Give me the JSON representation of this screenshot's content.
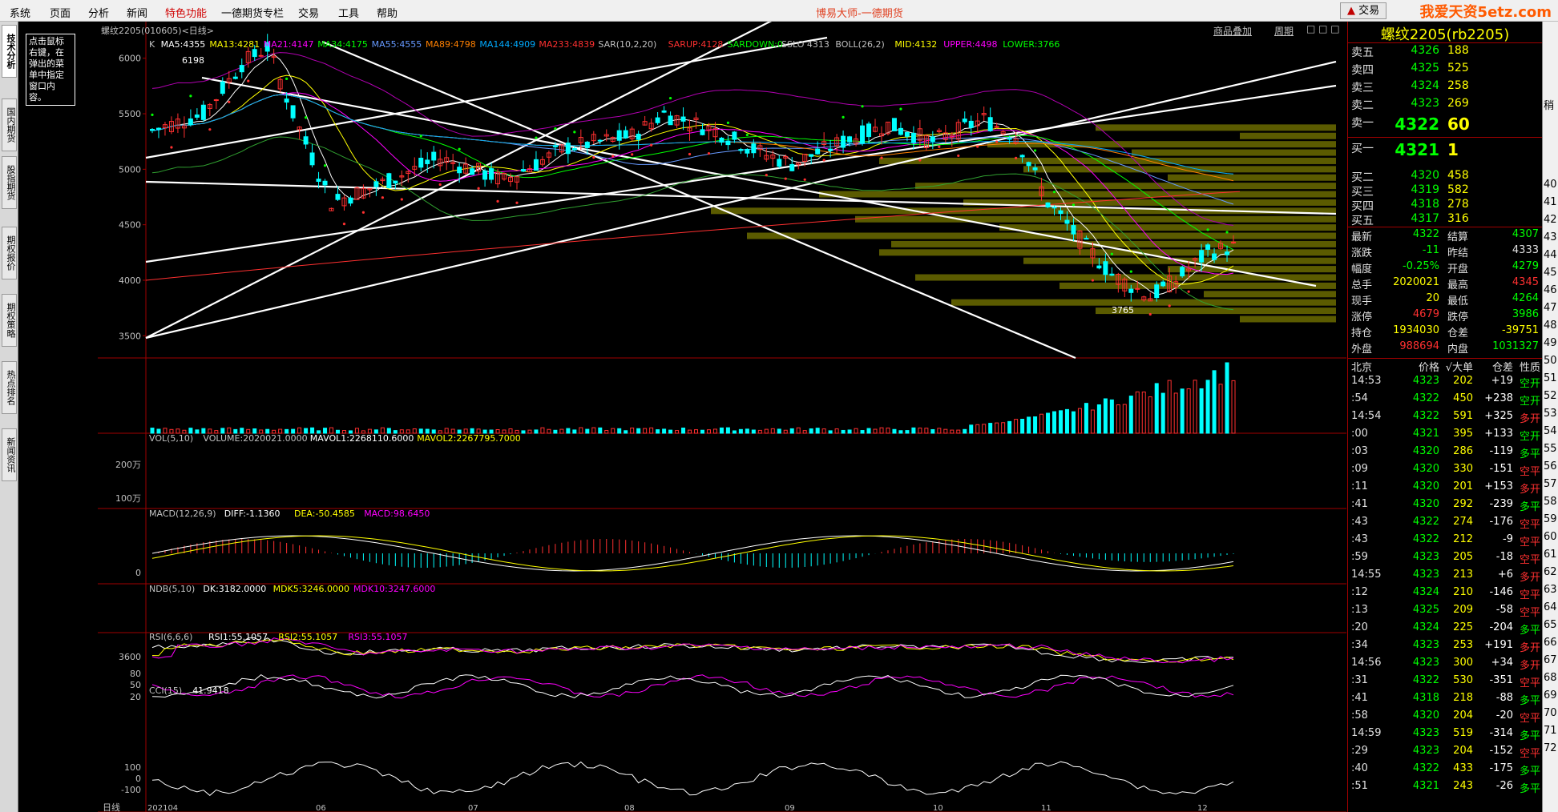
{
  "menu": {
    "items": [
      "系统",
      "页面",
      "分析",
      "新闻",
      "特色功能",
      "一德期货专栏",
      "交易",
      "工具",
      "帮助"
    ],
    "highlighted": "特色功能",
    "app_title": "博易大师-一德期货",
    "trade_button": "交易",
    "watermark": "我爱天资5etz.com"
  },
  "left_tabs": [
    "技术分析",
    "国内期货",
    "股指期货",
    "期权报价",
    "期权策略",
    "热点排名",
    "新闻资讯"
  ],
  "tooltip": "点击鼠标右键，在弹出的菜单中指定窗口内容。",
  "chart_header": {
    "title": "螺纹2205(010605)<日线>",
    "overlay_link": "商品叠加",
    "period_link": "周期"
  },
  "price_panel": {
    "indicator_line": [
      {
        "text": "K",
        "color": "#c0c0c0"
      },
      {
        "text": "MA5:4355",
        "color": "#ffffff"
      },
      {
        "text": "MA13:4281",
        "color": "#ffff00"
      },
      {
        "text": "MA21:4147",
        "color": "#ff00ff"
      },
      {
        "text": "MA34:4175",
        "color": "#00ff00"
      },
      {
        "text": "MA55:4555",
        "color": "#6699ff"
      },
      {
        "text": "MA89:4798",
        "color": "#ff8000"
      },
      {
        "text": "MA144:4909",
        "color": "#00aaff"
      },
      {
        "text": "MA233:4839",
        "color": "#ff3030"
      },
      {
        "text": "SAR(10,2,20)",
        "color": "#c0c0c0"
      },
      {
        "text": "SARUP:4128",
        "color": "#ff3030"
      },
      {
        "text": "SARDOWN:0",
        "color": "#00ff00"
      },
      {
        "text": "SSLO 4313",
        "color": "#c0c0c0"
      },
      {
        "text": "BOLL(26,2)",
        "color": "#c0c0c0"
      },
      {
        "text": "MID:4132",
        "color": "#ffff00"
      },
      {
        "text": "UPPER:4498",
        "color": "#ff00ff"
      },
      {
        "text": "LOWER:3766",
        "color": "#00ff00"
      }
    ],
    "y_ticks": [
      "6000",
      "5500",
      "5000",
      "4500",
      "4000",
      "3500"
    ],
    "y_tick_values": [
      6000,
      5500,
      5000,
      4500,
      4000,
      3500
    ],
    "high_label": "6198",
    "low_label": "3765"
  },
  "volume_panel": {
    "indicator_line": [
      {
        "text": "VOL(5,10)",
        "color": "#c0c0c0"
      },
      {
        "text": "VOLUME:2020021.0000",
        "color": "#c0c0c0"
      },
      {
        "text": "MAVOL1:2268110.6000",
        "color": "#ffffff"
      },
      {
        "text": "MAVOL2:2267795.7000",
        "color": "#ffff00"
      }
    ],
    "y_ticks": [
      "200万",
      "100万"
    ]
  },
  "macd_panel": {
    "indicator_line": [
      {
        "text": "MACD(12,26,9)",
        "color": "#c0c0c0"
      },
      {
        "text": "DIFF:-1.1360",
        "color": "#ffffff"
      },
      {
        "text": "DEA:-50.4585",
        "color": "#ffff00"
      },
      {
        "text": "MACD:98.6450",
        "color": "#ff00ff"
      }
    ],
    "y_ticks": [
      "0"
    ]
  },
  "ndb_panel": {
    "indicator_line": [
      {
        "text": "NDB(5,10)",
        "color": "#c0c0c0"
      },
      {
        "text": "DK:3182.0000",
        "color": "#ffffff"
      },
      {
        "text": "MDK5:3246.0000",
        "color": "#ffff00"
      },
      {
        "text": "MDK10:3247.6000",
        "color": "#ff00ff"
      }
    ],
    "y_ticks": [
      "3600"
    ]
  },
  "rsi_panel": {
    "indicator_line": [
      {
        "text": "RSI(6,6,6)",
        "color": "#c0c0c0"
      },
      {
        "text": "RSI1:55.1057",
        "color": "#ffffff"
      },
      {
        "text": "RSI2:55.1057",
        "color": "#ffff00"
      },
      {
        "text": "RSI3:55.1057",
        "color": "#ff00ff"
      }
    ],
    "y_ticks": [
      "80",
      "50",
      "20"
    ]
  },
  "cci_panel": {
    "indicator_line": [
      {
        "text": "CCI(15)",
        "color": "#c0c0c0"
      },
      {
        "text": "41.9418",
        "color": "#ffffff"
      }
    ],
    "y_ticks": [
      "100",
      "0",
      "-100"
    ]
  },
  "x_axis": {
    "label": "日线",
    "ticks": [
      "202104",
      "06",
      "07",
      "08",
      "09",
      "10",
      "11",
      "12"
    ]
  },
  "quote": {
    "title": "螺纹2205(rb2205)",
    "asks": [
      {
        "label": "卖五",
        "price": "4326",
        "vol": "188"
      },
      {
        "label": "卖四",
        "price": "4325",
        "vol": "525"
      },
      {
        "label": "卖三",
        "price": "4324",
        "vol": "258"
      },
      {
        "label": "卖二",
        "price": "4323",
        "vol": "269"
      },
      {
        "label": "卖一",
        "price": "4322",
        "vol": "60"
      }
    ],
    "bids": [
      {
        "label": "买一",
        "price": "4321",
        "vol": "1"
      },
      {
        "label": "买二",
        "price": "4320",
        "vol": "458"
      },
      {
        "label": "买三",
        "price": "4319",
        "vol": "582"
      },
      {
        "label": "买四",
        "price": "4318",
        "vol": "278"
      },
      {
        "label": "买五",
        "price": "4317",
        "vol": "316"
      }
    ],
    "stats": [
      {
        "l1": "最新",
        "v1": "4322",
        "c1": "#00ff00",
        "l2": "结算",
        "v2": "4307",
        "c2": "#00ff00"
      },
      {
        "l1": "涨跌",
        "v1": "-11",
        "c1": "#00ff00",
        "l2": "昨结",
        "v2": "4333",
        "c2": "#e0e0e0"
      },
      {
        "l1": "幅度",
        "v1": "-0.25%",
        "c1": "#00ff00",
        "l2": "开盘",
        "v2": "4279",
        "c2": "#00ff00"
      },
      {
        "l1": "总手",
        "v1": "2020021",
        "c1": "#ffff00",
        "l2": "最高",
        "v2": "4345",
        "c2": "#ff3030"
      },
      {
        "l1": "现手",
        "v1": "20",
        "c1": "#ffff00",
        "l2": "最低",
        "v2": "4264",
        "c2": "#00ff00"
      },
      {
        "l1": "涨停",
        "v1": "4679",
        "c1": "#ff3030",
        "l2": "跌停",
        "v2": "3986",
        "c2": "#00ff00"
      },
      {
        "l1": "持仓",
        "v1": "1934030",
        "c1": "#ffff00",
        "l2": "仓差",
        "v2": "-39751",
        "c2": "#ffff00"
      },
      {
        "l1": "外盘",
        "v1": "988694",
        "c1": "#ff3030",
        "l2": "内盘",
        "v2": "1031327",
        "c2": "#00ff00"
      }
    ],
    "tick_header": {
      "t": "北京",
      "p": "价格",
      "v": "√大单",
      "d": "仓差",
      "n": "性质"
    },
    "ticks": [
      {
        "t": "14:53",
        "p": "4323",
        "v": "202",
        "d": "+19",
        "n": "空开",
        "pc": "#00ff00",
        "dc": "#ffffff",
        "nc": "#00ff00"
      },
      {
        "t": ":54",
        "p": "4322",
        "v": "450",
        "d": "+238",
        "n": "空开",
        "pc": "#00ff00",
        "dc": "#ffffff",
        "nc": "#00ff00"
      },
      {
        "t": "14:54",
        "p": "4322",
        "v": "591",
        "d": "+325",
        "n": "多开",
        "pc": "#00ff00",
        "dc": "#ffffff",
        "nc": "#ff3030"
      },
      {
        "t": ":00",
        "p": "4321",
        "v": "395",
        "d": "+133",
        "n": "空开",
        "pc": "#00ff00",
        "dc": "#ffffff",
        "nc": "#00ff00"
      },
      {
        "t": ":03",
        "p": "4320",
        "v": "286",
        "d": "-119",
        "n": "多平",
        "pc": "#00ff00",
        "dc": "#ffffff",
        "nc": "#00ff00"
      },
      {
        "t": ":09",
        "p": "4320",
        "v": "330",
        "d": "-151",
        "n": "空平",
        "pc": "#00ff00",
        "dc": "#ffffff",
        "nc": "#ff3030"
      },
      {
        "t": ":11",
        "p": "4320",
        "v": "201",
        "d": "+153",
        "n": "多开",
        "pc": "#00ff00",
        "dc": "#ffffff",
        "nc": "#ff3030"
      },
      {
        "t": ":41",
        "p": "4320",
        "v": "292",
        "d": "-239",
        "n": "多平",
        "pc": "#00ff00",
        "dc": "#ffffff",
        "nc": "#00ff00"
      },
      {
        "t": ":43",
        "p": "4322",
        "v": "274",
        "d": "-176",
        "n": "空平",
        "pc": "#00ff00",
        "dc": "#ffffff",
        "nc": "#ff3030"
      },
      {
        "t": ":43",
        "p": "4322",
        "v": "212",
        "d": "-9",
        "n": "空平",
        "pc": "#00ff00",
        "dc": "#ffffff",
        "nc": "#ff3030"
      },
      {
        "t": ":59",
        "p": "4323",
        "v": "205",
        "d": "-18",
        "n": "空平",
        "pc": "#00ff00",
        "dc": "#ffffff",
        "nc": "#ff3030"
      },
      {
        "t": "14:55",
        "p": "4323",
        "v": "213",
        "d": "+6",
        "n": "多开",
        "pc": "#00ff00",
        "dc": "#ffffff",
        "nc": "#ff3030"
      },
      {
        "t": ":12",
        "p": "4324",
        "v": "210",
        "d": "-146",
        "n": "空平",
        "pc": "#00ff00",
        "dc": "#ffffff",
        "nc": "#ff3030"
      },
      {
        "t": ":13",
        "p": "4325",
        "v": "209",
        "d": "-58",
        "n": "空平",
        "pc": "#00ff00",
        "dc": "#ffffff",
        "nc": "#ff3030"
      },
      {
        "t": ":20",
        "p": "4324",
        "v": "225",
        "d": "-204",
        "n": "多平",
        "pc": "#00ff00",
        "dc": "#ffffff",
        "nc": "#00ff00"
      },
      {
        "t": ":34",
        "p": "4323",
        "v": "253",
        "d": "+191",
        "n": "多开",
        "pc": "#00ff00",
        "dc": "#ffffff",
        "nc": "#ff3030"
      },
      {
        "t": "14:56",
        "p": "4323",
        "v": "300",
        "d": "+34",
        "n": "多开",
        "pc": "#00ff00",
        "dc": "#ffffff",
        "nc": "#ff3030"
      },
      {
        "t": ":31",
        "p": "4322",
        "v": "530",
        "d": "-351",
        "n": "空平",
        "pc": "#00ff00",
        "dc": "#ffffff",
        "nc": "#ff3030"
      },
      {
        "t": ":41",
        "p": "4318",
        "v": "218",
        "d": "-88",
        "n": "多平",
        "pc": "#00ff00",
        "dc": "#ffffff",
        "nc": "#00ff00"
      },
      {
        "t": ":58",
        "p": "4320",
        "v": "204",
        "d": "-20",
        "n": "空平",
        "pc": "#00ff00",
        "dc": "#ffffff",
        "nc": "#ff3030"
      },
      {
        "t": "14:59",
        "p": "4323",
        "v": "519",
        "d": "-314",
        "n": "多平",
        "pc": "#00ff00",
        "dc": "#ffffff",
        "nc": "#00ff00"
      },
      {
        "t": ":29",
        "p": "4323",
        "v": "204",
        "d": "-152",
        "n": "空平",
        "pc": "#00ff00",
        "dc": "#ffffff",
        "nc": "#ff3030"
      },
      {
        "t": ":40",
        "p": "4322",
        "v": "433",
        "d": "-175",
        "n": "多平",
        "pc": "#00ff00",
        "dc": "#ffffff",
        "nc": "#00ff00"
      },
      {
        "t": ":51",
        "p": "4321",
        "v": "243",
        "d": "-26",
        "n": "多平",
        "pc": "#00ff00",
        "dc": "#ffffff",
        "nc": "#00ff00"
      }
    ]
  },
  "far_right_numbers": [
    "40",
    "41",
    "42",
    "43",
    "44",
    "45",
    "46",
    "47",
    "48",
    "49",
    "50",
    "51",
    "52",
    "53",
    "54",
    "55",
    "56",
    "57",
    "58",
    "59",
    "60",
    "61",
    "62",
    "63",
    "64",
    "65",
    "66",
    "67",
    "68",
    "69",
    "70",
    "71",
    "72"
  ],
  "far_right_labels": [
    "稍"
  ],
  "colors": {
    "up": "#ff3030",
    "down": "#00ffff",
    "grid": "#a00000",
    "trendline": "#ffffff",
    "volume_profile": "#6b6b00"
  }
}
